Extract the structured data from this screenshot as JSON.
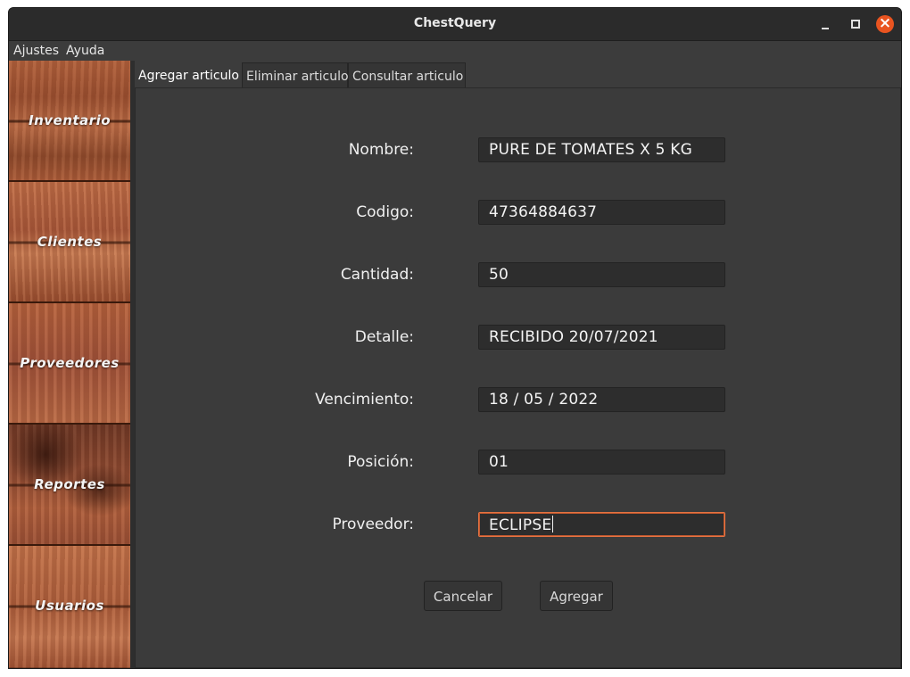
{
  "window": {
    "title": "ChestQuery"
  },
  "menubar": {
    "items": [
      "Ajustes",
      "Ayuda"
    ]
  },
  "sidebar": {
    "items": [
      "Inventario",
      "Clientes",
      "Proveedores",
      "Reportes",
      "Usuarios"
    ]
  },
  "tabs": [
    "Agregar articulo",
    "Eliminar articulo",
    "Consultar articulo"
  ],
  "form": {
    "fields": [
      {
        "label": "Nombre:",
        "value": "PURE DE TOMATES X 5 KG"
      },
      {
        "label": "Codigo:",
        "value": "47364884637"
      },
      {
        "label": "Cantidad:",
        "value": "50"
      },
      {
        "label": "Detalle:",
        "value": "RECIBIDO 20/07/2021"
      },
      {
        "label": "Vencimiento:",
        "value": "18 / 05 / 2022"
      },
      {
        "label": "Posición:",
        "value": "01"
      },
      {
        "label": "Proveedor:",
        "value": "ECLIPSE"
      }
    ],
    "cancel_label": "Cancelar",
    "submit_label": "Agregar"
  },
  "colors": {
    "accent": "#e95420",
    "focus_border": "#e57342",
    "background": "#3c3c3c"
  }
}
